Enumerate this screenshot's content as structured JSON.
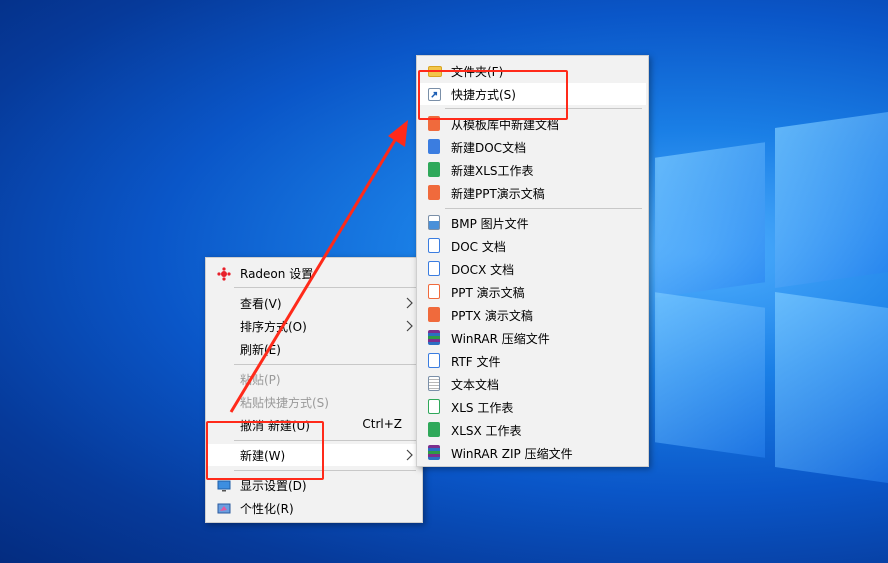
{
  "colors": {
    "accent_red": "#ff2a1a",
    "desktop_blue": "#0a56c8",
    "menu_bg": "#f2f2f2"
  },
  "context_menu": {
    "items": [
      {
        "label": "Radeon 设置",
        "icon": "radeon-icon"
      },
      {
        "label": "查看(V)",
        "submenu": true
      },
      {
        "label": "排序方式(O)",
        "submenu": true
      },
      {
        "label": "刷新(E)"
      },
      {
        "label": "粘贴(P)",
        "disabled": true
      },
      {
        "label": "粘贴快捷方式(S)",
        "disabled": true
      },
      {
        "label": "撤消 新建(U)",
        "shortcut": "Ctrl+Z"
      },
      {
        "label": "新建(W)",
        "submenu": true
      },
      {
        "label": "显示设置(D)",
        "icon": "display-icon"
      },
      {
        "label": "个性化(R)",
        "icon": "personalize-icon"
      }
    ]
  },
  "new_submenu": {
    "items": [
      {
        "label": "文件夹(F)",
        "icon": "folder-icon"
      },
      {
        "label": "快捷方式(S)",
        "icon": "shortcut-icon"
      },
      {
        "label": "从模板库中新建文档",
        "icon": "template-icon"
      },
      {
        "label": "新建DOC文档",
        "icon": "wps-writer-icon"
      },
      {
        "label": "新建XLS工作表",
        "icon": "wps-sheet-icon"
      },
      {
        "label": "新建PPT演示文稿",
        "icon": "wps-present-icon"
      },
      {
        "label": "BMP 图片文件",
        "icon": "bmp-file-icon"
      },
      {
        "label": "DOC 文档",
        "icon": "doc-file-icon"
      },
      {
        "label": "DOCX 文档",
        "icon": "docx-file-icon"
      },
      {
        "label": "PPT 演示文稿",
        "icon": "ppt-file-icon"
      },
      {
        "label": "PPTX 演示文稿",
        "icon": "pptx-file-icon"
      },
      {
        "label": "WinRAR 压缩文件",
        "icon": "winrar-icon"
      },
      {
        "label": "RTF 文件",
        "icon": "rtf-file-icon"
      },
      {
        "label": "文本文档",
        "icon": "text-file-icon"
      },
      {
        "label": "XLS 工作表",
        "icon": "xls-file-icon"
      },
      {
        "label": "XLSX 工作表",
        "icon": "xlsx-file-icon"
      },
      {
        "label": "WinRAR ZIP 压缩文件",
        "icon": "winrar-zip-icon"
      }
    ]
  }
}
